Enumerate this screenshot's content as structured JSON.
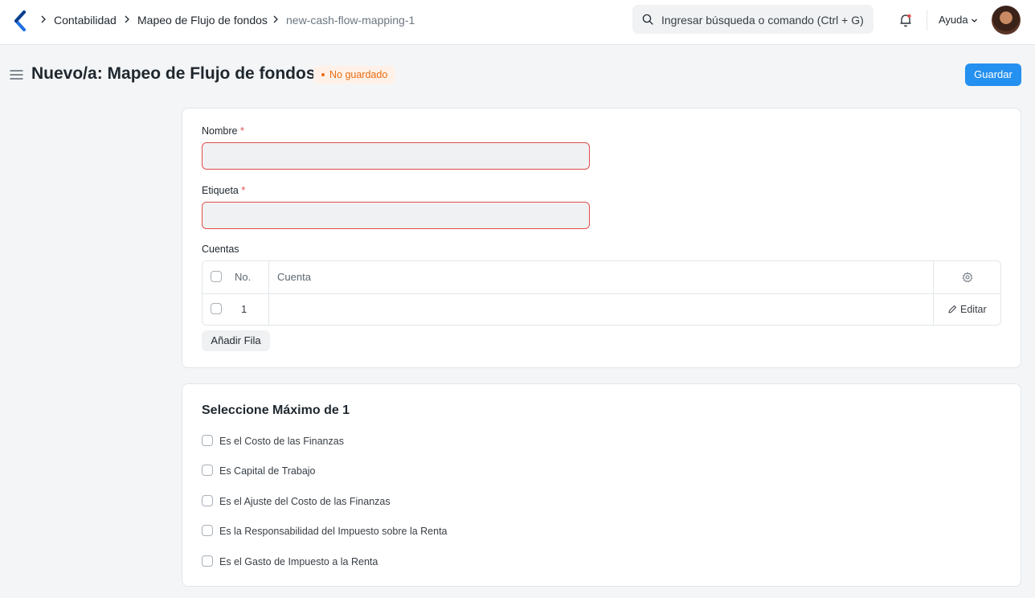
{
  "navbar": {
    "breadcrumbs": [
      "Contabilidad",
      "Mapeo de Flujo de fondos",
      "new-cash-flow-mapping-1"
    ],
    "search_placeholder": "Ingresar búsqueda o comando (Ctrl + G)",
    "help_label": "Ayuda"
  },
  "header": {
    "title": "Nuevo/a: Mapeo de Flujo de fondos",
    "status": "No guardado",
    "save_label": "Guardar"
  },
  "form": {
    "name_label": "Nombre",
    "tag_label": "Etiqueta",
    "required_mark": "*",
    "accounts_label": "Cuentas",
    "accounts_table": {
      "columns": [
        "No.",
        "Cuenta"
      ],
      "rows": [
        {
          "no": "1",
          "account": ""
        }
      ],
      "edit_label": "Editar"
    },
    "add_row_label": "Añadir Fila"
  },
  "select_section": {
    "title": "Seleccione Máximo de 1",
    "options": [
      {
        "label": "Es el Costo de las Finanzas",
        "checked": false
      },
      {
        "label": "Es Capital de Trabajo",
        "checked": false
      },
      {
        "label": "Es el Ajuste del Costo de las Finanzas",
        "checked": false
      },
      {
        "label": "Es la Responsabilidad del Impuesto sobre la Renta",
        "checked": false
      },
      {
        "label": "Es el Gasto de Impuesto a la Renta",
        "checked": false
      }
    ]
  },
  "colors": {
    "primary": "#2490ef",
    "error_border": "#e24c4c",
    "status_text": "#e86c13",
    "status_bg": "#fff1e7",
    "page_bg": "#f4f5f6"
  },
  "icons": [
    "app-logo-icon",
    "chevron-right-icon",
    "search-icon",
    "bell-icon",
    "chevron-down-icon",
    "menu-icon",
    "gear-icon",
    "pencil-icon"
  ]
}
